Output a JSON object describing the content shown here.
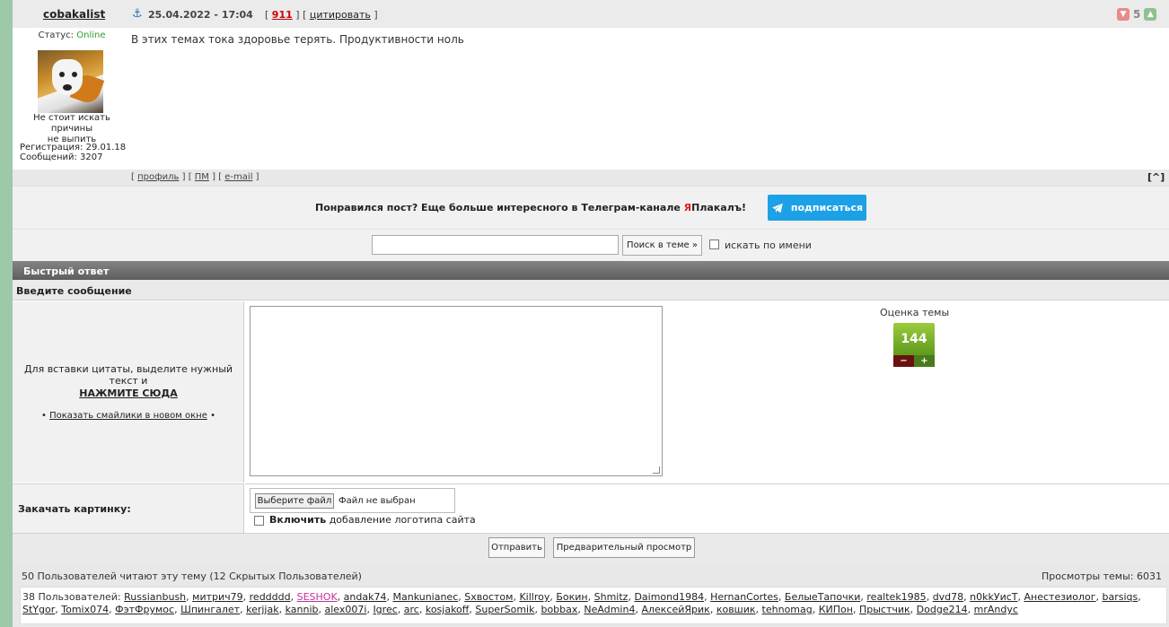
{
  "post": {
    "author": "cobakalist",
    "date": "25.04.2022 - 17:04",
    "num_open": "[",
    "num": "911",
    "num_close": "]",
    "cite_open": "[",
    "cite": "цитировать",
    "cite_close": "]",
    "rating": "5",
    "status_label": "Статус:",
    "status": "Online",
    "user_title_1": "Не стоит искать причины",
    "user_title_2": "не выпить",
    "reg": "Регистрация: 29.01.18",
    "posts": "Сообщений: 3207",
    "text": "В этих темах тока здоровье терять. Продуктивности ноль",
    "links": {
      "profile": "профиль",
      "pm": "ПМ",
      "email": "e-mail"
    },
    "to_top": "[^]"
  },
  "telegram": {
    "text_before": "Понравился пост? Еще больше интересного в Телеграм-канале ",
    "ya": "Я",
    "text_after": "Плакалъ!",
    "button": "подписаться"
  },
  "search": {
    "button": "Поиск в теме »",
    "by_name": "искать по имени"
  },
  "quick_reply": {
    "title": "Быстрый ответ",
    "enter_message": "Введите сообщение",
    "hint": "Для вставки цитаты, выделите нужный текст и",
    "hint_click": "НАЖМИТЕ СЮДА",
    "smiles_prefix": "•",
    "smiles_link": "Показать смайлики в новом окне",
    "smiles_suffix": "•",
    "topic_rating_label": "Оценка темы",
    "topic_rating": "144",
    "upload_label": "Закачать картинку:",
    "choose_file": "Выберите файл",
    "no_file": "Файл не выбран",
    "logo_bold": "Включить",
    "logo_rest": "добавление логотипа сайта",
    "send": "Отправить",
    "preview": "Предварительный просмотр"
  },
  "readers": {
    "count": "50 Пользователей читают эту тему (12 Скрытых Пользователей)",
    "views": "Просмотры темы: 6031",
    "users_prefix": "38 Пользователей:",
    "users": [
      "Russianbush",
      "митрич79",
      "reddddd",
      "SESHOK",
      "andak74",
      "Mankunianec",
      "Sхвостом",
      "Killroy",
      "Бокин",
      "Shmitz",
      "Daimond1984",
      "HernanCortes",
      "БелыеТапочки",
      "realtek1985",
      "dvd78",
      "n0kkУисТ",
      "Анестезиолог",
      "barsiqs",
      "StYgor",
      "Tomix074",
      "ФэтФрумос",
      "Шпингалет",
      "kerjjak",
      "kannib",
      "alex007i",
      "Igrec",
      "arc",
      "kosjakoff",
      "SuperSomik",
      "bobbax",
      "NeAdmin4",
      "АлексейЯрик",
      "ковшик",
      "tehnomag",
      "КИПон",
      "Прыстчик",
      "Dodge214",
      "mrAndyc"
    ],
    "highlight_user": "SESHOK"
  },
  "colors": {
    "online": "#2a9d2a",
    "telegram_button": "#1ca1e6",
    "topic_rating": "#7fb52c",
    "highlight_user": "#c0339a"
  }
}
